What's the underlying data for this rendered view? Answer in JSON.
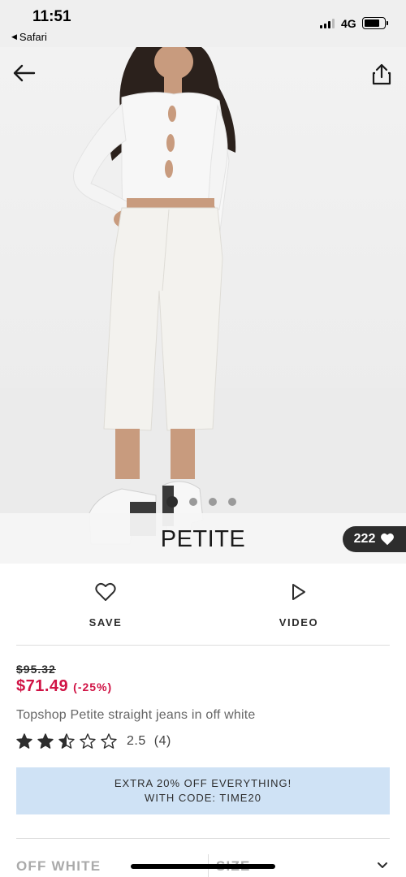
{
  "status_bar": {
    "time": "11:51",
    "back_app": "Safari",
    "network": "4G"
  },
  "hero": {
    "badge": "PETITE",
    "likes": "222",
    "dots_total": 4,
    "dots_active": 1
  },
  "actions": {
    "save_label": "SAVE",
    "video_label": "VIDEO"
  },
  "product": {
    "old_price": "$95.32",
    "price": "$71.49",
    "discount": "(-25%)",
    "title": "Topshop Petite straight jeans in off white",
    "rating_value": "2.5",
    "rating_count": "(4)",
    "rating_stars": 2.5
  },
  "promo": {
    "line1": "EXTRA 20% OFF EVERYTHING!",
    "line2": "WITH CODE: TIME20"
  },
  "selectors": {
    "colour": "OFF WHITE",
    "size": "SIZE"
  },
  "colors": {
    "sale_red": "#d01345",
    "promo_blue": "#cfe2f5",
    "text_dark": "#2d2d2d"
  }
}
